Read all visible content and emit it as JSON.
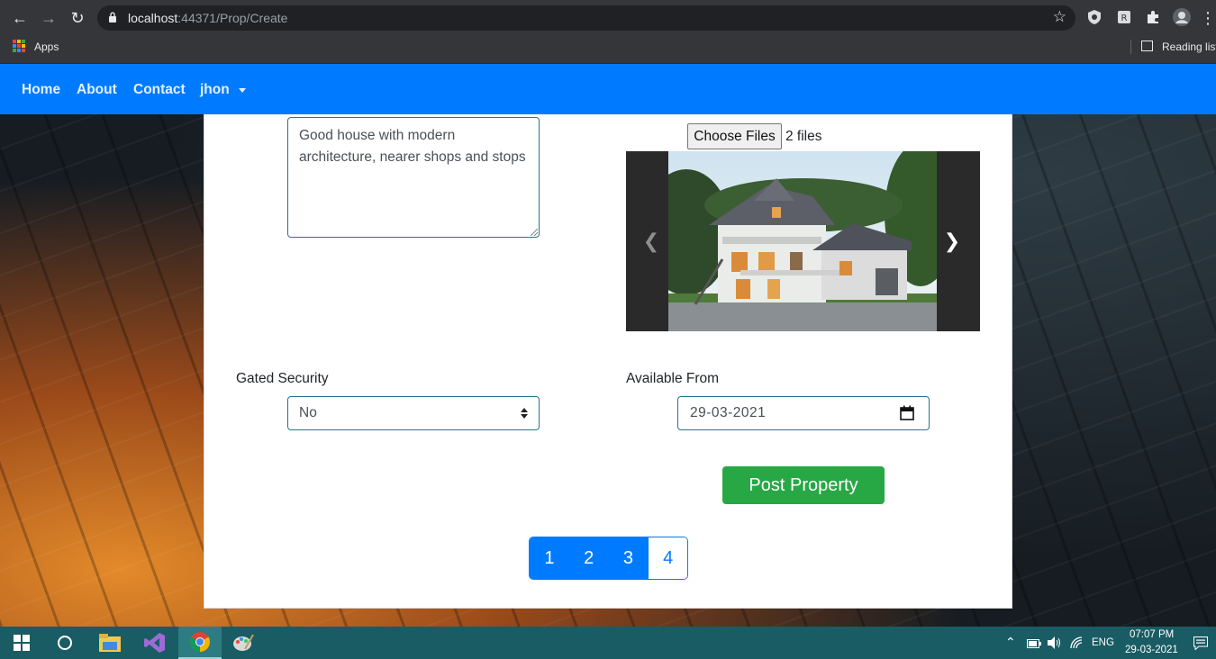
{
  "browser": {
    "url_host": "localhost",
    "url_rest": ":44371/Prop/Create",
    "bookmarks_apps": "Apps",
    "reading_list": "Reading list"
  },
  "navbar": {
    "home": "Home",
    "about": "About",
    "contact": "Contact",
    "user": "jhon"
  },
  "form": {
    "description_value": "Good house with modern architecture, nearer shops and stops",
    "file_button": "Choose Files",
    "file_count": "2 files",
    "gated_security_label": "Gated Security",
    "gated_security_value": "No",
    "available_from_label": "Available From",
    "available_from_value": "29-03-2021",
    "submit_label": "Post Property"
  },
  "pagination": {
    "pages": [
      "1",
      "2",
      "3",
      "4"
    ]
  },
  "taskbar": {
    "language": "ENG",
    "time": "07:07 PM",
    "date": "29-03-2021"
  },
  "colors": {
    "primary": "#007bff",
    "success": "#28a745",
    "taskbar": "#1a5c63"
  }
}
